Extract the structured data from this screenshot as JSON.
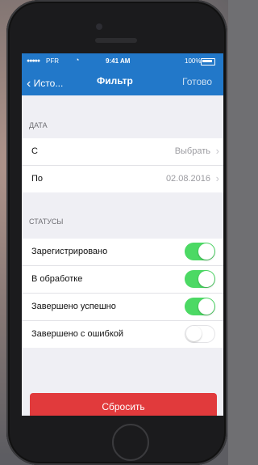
{
  "status_bar": {
    "carrier": "PFR",
    "time": "9:41 AM",
    "battery": "100%"
  },
  "nav": {
    "back_label": "Исто...",
    "title": "Фильтр",
    "done_label": "Готово"
  },
  "date_section": {
    "header": "ДАТА",
    "rows": [
      {
        "label": "С",
        "value": "Выбрать"
      },
      {
        "label": "По",
        "value": "02.08.2016"
      }
    ]
  },
  "statuses_section": {
    "header": "СТАТУСЫ",
    "rows": [
      {
        "label": "Зарегистрировано",
        "enabled": true
      },
      {
        "label": "В обработке",
        "enabled": true
      },
      {
        "label": "Завершено успешно",
        "enabled": true
      },
      {
        "label": "Завершено с ошибкой",
        "enabled": false
      }
    ]
  },
  "reset_label": "Сбросить",
  "colors": {
    "nav_bg": "#2278c9",
    "toggle_on": "#4cd964",
    "reset_bg": "#e13a3c"
  }
}
